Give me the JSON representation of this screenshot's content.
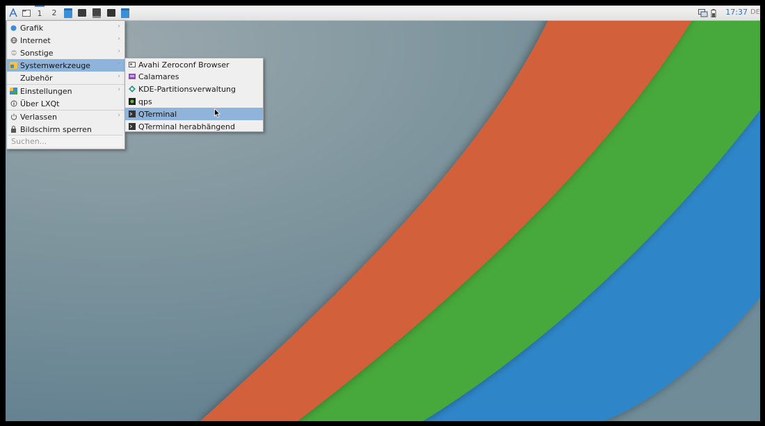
{
  "panel": {
    "desktops": [
      "1",
      "2"
    ],
    "clock": "17:37",
    "keyboard_layout": "DE"
  },
  "main_menu": {
    "items": [
      {
        "label": "Grafik",
        "icon": "graphics-icon",
        "submenu": true
      },
      {
        "label": "Internet",
        "icon": "internet-globe-icon",
        "submenu": true
      },
      {
        "label": "Sonstige",
        "icon": "other-apps-icon",
        "submenu": true
      },
      {
        "label": "Systemwerkzeuge",
        "icon": "system-tools-icon",
        "submenu": true,
        "highlighted": true
      },
      {
        "label": "Zubehör",
        "icon": "",
        "submenu": true
      },
      {
        "label": "Einstellungen",
        "icon": "settings-icon",
        "submenu": true
      },
      {
        "label": "Über LXQt",
        "icon": "info-icon",
        "submenu": false
      },
      {
        "label": "Verlassen",
        "icon": "power-icon",
        "submenu": true
      },
      {
        "label": "Bildschirm sperren",
        "icon": "lock-icon",
        "submenu": false
      }
    ],
    "search_placeholder": "Suchen..."
  },
  "sub_menu": {
    "items": [
      {
        "label": "Avahi Zeroconf Browser",
        "icon": "avahi-icon"
      },
      {
        "label": "Calamares",
        "icon": "calamares-icon"
      },
      {
        "label": "KDE-Partitionsverwaltung",
        "icon": "partition-manager-icon"
      },
      {
        "label": "qps",
        "icon": "qps-icon"
      },
      {
        "label": "QTerminal",
        "icon": "terminal-icon",
        "highlighted": true
      },
      {
        "label": "QTerminal herabhängend",
        "icon": "terminal-dropdown-icon"
      }
    ]
  },
  "colors": {
    "highlight": "#8fb4db",
    "orange": "#d2603a",
    "green": "#46a83b",
    "blue": "#2d86c8",
    "wallpaper_gray": "#6a8594",
    "clock": "#2a6cc0"
  }
}
